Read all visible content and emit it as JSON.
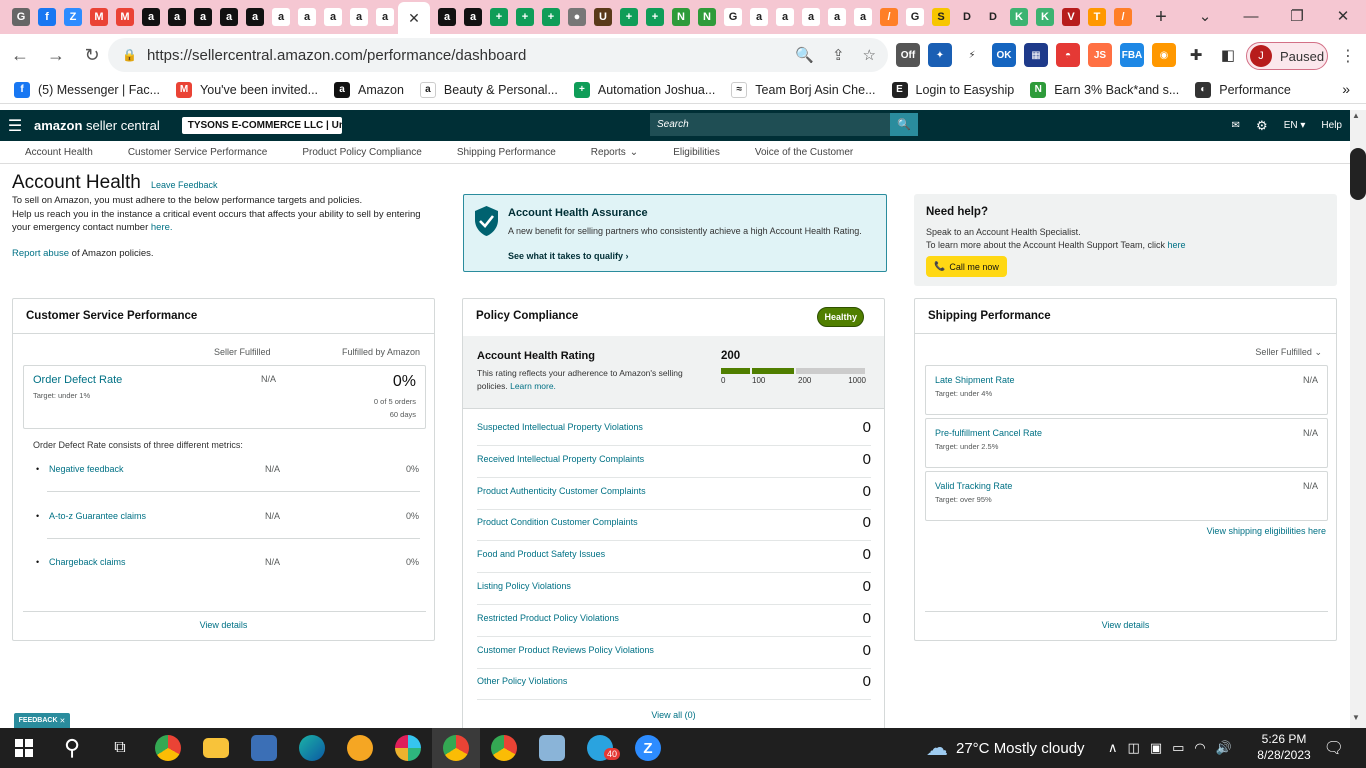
{
  "browser": {
    "url": "https://sellercentral.amazon.com/performance/dashboard",
    "profile_initial": "J",
    "profile_status": "Paused",
    "tab_icons": [
      {
        "letter": "G",
        "color": "#666"
      },
      {
        "letter": "f",
        "color": "#1877f2"
      },
      {
        "letter": "Z",
        "color": "#2d8cff"
      },
      {
        "letter": "M",
        "color": "#ea4335"
      },
      {
        "letter": "M",
        "color": "#ea4335"
      },
      {
        "letter": "a",
        "color": "#111"
      },
      {
        "letter": "a",
        "color": "#111"
      },
      {
        "letter": "a",
        "color": "#111"
      },
      {
        "letter": "a",
        "color": "#111"
      },
      {
        "letter": "a",
        "color": "#111"
      },
      {
        "letter": "a",
        "color": "#ffffff"
      },
      {
        "letter": "a",
        "color": "#ffffff"
      },
      {
        "letter": "a",
        "color": "#ffffff"
      },
      {
        "letter": "a",
        "color": "#ffffff"
      },
      {
        "letter": "a",
        "color": "#ffffff"
      }
    ],
    "tab_icons_right": [
      {
        "letter": "a",
        "color": "#111"
      },
      {
        "letter": "a",
        "color": "#111"
      },
      {
        "letter": "+",
        "color": "#0f9d58"
      },
      {
        "letter": "+",
        "color": "#0f9d58"
      },
      {
        "letter": "+",
        "color": "#0f9d58"
      },
      {
        "letter": "●",
        "color": "#777"
      },
      {
        "letter": "U",
        "color": "#5a3a1a"
      },
      {
        "letter": "+",
        "color": "#0f9d58"
      },
      {
        "letter": "+",
        "color": "#0f9d58"
      },
      {
        "letter": "N",
        "color": "#2e9b3a"
      },
      {
        "letter": "N",
        "color": "#2e9b3a"
      },
      {
        "letter": "G",
        "color": "#ffffff"
      },
      {
        "letter": "a",
        "color": "#ffffff"
      },
      {
        "letter": "a",
        "color": "#ffffff"
      },
      {
        "letter": "a",
        "color": "#ffffff"
      },
      {
        "letter": "a",
        "color": "#ffffff"
      },
      {
        "letter": "a",
        "color": "#ffffff"
      },
      {
        "letter": "/",
        "color": "#ff7f27"
      },
      {
        "letter": "G",
        "color": "#ffffff"
      },
      {
        "letter": "S",
        "color": "#f7c600"
      },
      {
        "letter": "D",
        "color": "#f5c7d2"
      },
      {
        "letter": "D",
        "color": "#f5c7d2"
      },
      {
        "letter": "K",
        "color": "#3cb371"
      },
      {
        "letter": "K",
        "color": "#3cb371"
      },
      {
        "letter": "V",
        "color": "#b71c1c"
      },
      {
        "letter": "T",
        "color": "#ff9800"
      },
      {
        "letter": "/",
        "color": "#ff7f27"
      }
    ],
    "bookmarks": [
      {
        "label": "(5) Messenger | Fac...",
        "icon": "f",
        "color": "#1877f2"
      },
      {
        "label": "You've been invited...",
        "icon": "M",
        "color": "#ea4335"
      },
      {
        "label": "Amazon",
        "icon": "a",
        "color": "#111"
      },
      {
        "label": "Beauty & Personal...",
        "icon": "a",
        "color": "#ffffff"
      },
      {
        "label": "Automation Joshua...",
        "icon": "+",
        "color": "#0f9d58"
      },
      {
        "label": "Team Borj Asin Che...",
        "icon": "≈",
        "color": "#ffffff"
      },
      {
        "label": "Login to Easyship",
        "icon": "E",
        "color": "#222"
      },
      {
        "label": "Earn 3% Back*and s...",
        "icon": "N",
        "color": "#2e9b3a"
      },
      {
        "label": "Performance",
        "icon": "◐",
        "color": "#333"
      }
    ]
  },
  "header": {
    "logo_bold": "amazon",
    "logo_rest": " seller central",
    "account": "TYSONS E-COMMERCE LLC | Uni...",
    "search_placeholder": "Search",
    "lang": "EN",
    "help": "Help"
  },
  "subnav": [
    "Account Health",
    "Customer Service Performance",
    "Product Policy Compliance",
    "Shipping Performance",
    "Reports",
    "Eligibilities",
    "Voice of the Customer"
  ],
  "page": {
    "title": "Account Health",
    "leave_feedback": "Leave Feedback",
    "desc1": "To sell on Amazon, you must adhere to the below performance targets and policies.",
    "desc2": "Help us reach you in the instance a critical event occurs that affects your ability to sell by entering your emergency contact number",
    "desc2_link": "here.",
    "report_link": "Report abuse",
    "report_rest": " of Amazon policies."
  },
  "assurance": {
    "title": "Account Health Assurance",
    "desc": "A new benefit for selling partners who consistently achieve a high Account Health Rating.",
    "link": "See what it takes to qualify"
  },
  "help": {
    "title": "Need help?",
    "line1": "Speak to an Account Health Specialist.",
    "line2": "To learn more about the Account Health Support Team, click",
    "line2_link": "here",
    "call_btn": "Call me now"
  },
  "csp": {
    "title": "Customer Service Performance",
    "col1": "Seller Fulfilled",
    "col2": "Fulfilled by Amazon",
    "odr_label": "Order Defect Rate",
    "odr_target": "Target: under 1%",
    "odr_sf": "N/A",
    "odr_fba": "0%",
    "odr_orders": "0 of 5 orders",
    "odr_days": "60 days",
    "consists": "Order Defect Rate consists of three different metrics:",
    "metrics": [
      {
        "label": "Negative feedback",
        "sf": "N/A",
        "fba": "0%"
      },
      {
        "label": "A-to-z Guarantee claims",
        "sf": "N/A",
        "fba": "0%"
      },
      {
        "label": "Chargeback claims",
        "sf": "N/A",
        "fba": "0%"
      }
    ],
    "view_details": "View details"
  },
  "policy": {
    "title": "Policy Compliance",
    "badge": "Healthy",
    "rating_title": "Account Health Rating",
    "rating_desc": "This rating reflects your adherence to Amazon's selling policies.",
    "learn_more": "Learn more.",
    "rating_value": "200",
    "scale": [
      "0",
      "100",
      "200",
      "1000"
    ],
    "rows": [
      {
        "label": "Suspected Intellectual Property Violations",
        "value": "0"
      },
      {
        "label": "Received Intellectual Property Complaints",
        "value": "0"
      },
      {
        "label": "Product Authenticity Customer Complaints",
        "value": "0"
      },
      {
        "label": "Product Condition Customer Complaints",
        "value": "0"
      },
      {
        "label": "Food and Product Safety Issues",
        "value": "0"
      },
      {
        "label": "Listing Policy Violations",
        "value": "0"
      },
      {
        "label": "Restricted Product Policy Violations",
        "value": "0"
      },
      {
        "label": "Customer Product Reviews Policy Violations",
        "value": "0"
      },
      {
        "label": "Other Policy Violations",
        "value": "0"
      }
    ],
    "view_all": "View all (0)"
  },
  "shipping": {
    "title": "Shipping Performance",
    "filter": "Seller Fulfilled",
    "rows": [
      {
        "label": "Late Shipment Rate",
        "target": "Target: under 4%",
        "value": "N/A"
      },
      {
        "label": "Pre-fulfillment Cancel Rate",
        "target": "Target: under 2.5%",
        "value": "N/A"
      },
      {
        "label": "Valid Tracking Rate",
        "target": "Target: over 95%",
        "value": "N/A"
      }
    ],
    "eligibilities_link": "View shipping eligibilities here",
    "view_details": "View details"
  },
  "feedback_tab": "FEEDBACK",
  "taskbar": {
    "temp": "27°C",
    "weather": "Mostly cloudy",
    "time": "5:26 PM",
    "date": "8/28/2023",
    "badge": "40"
  }
}
